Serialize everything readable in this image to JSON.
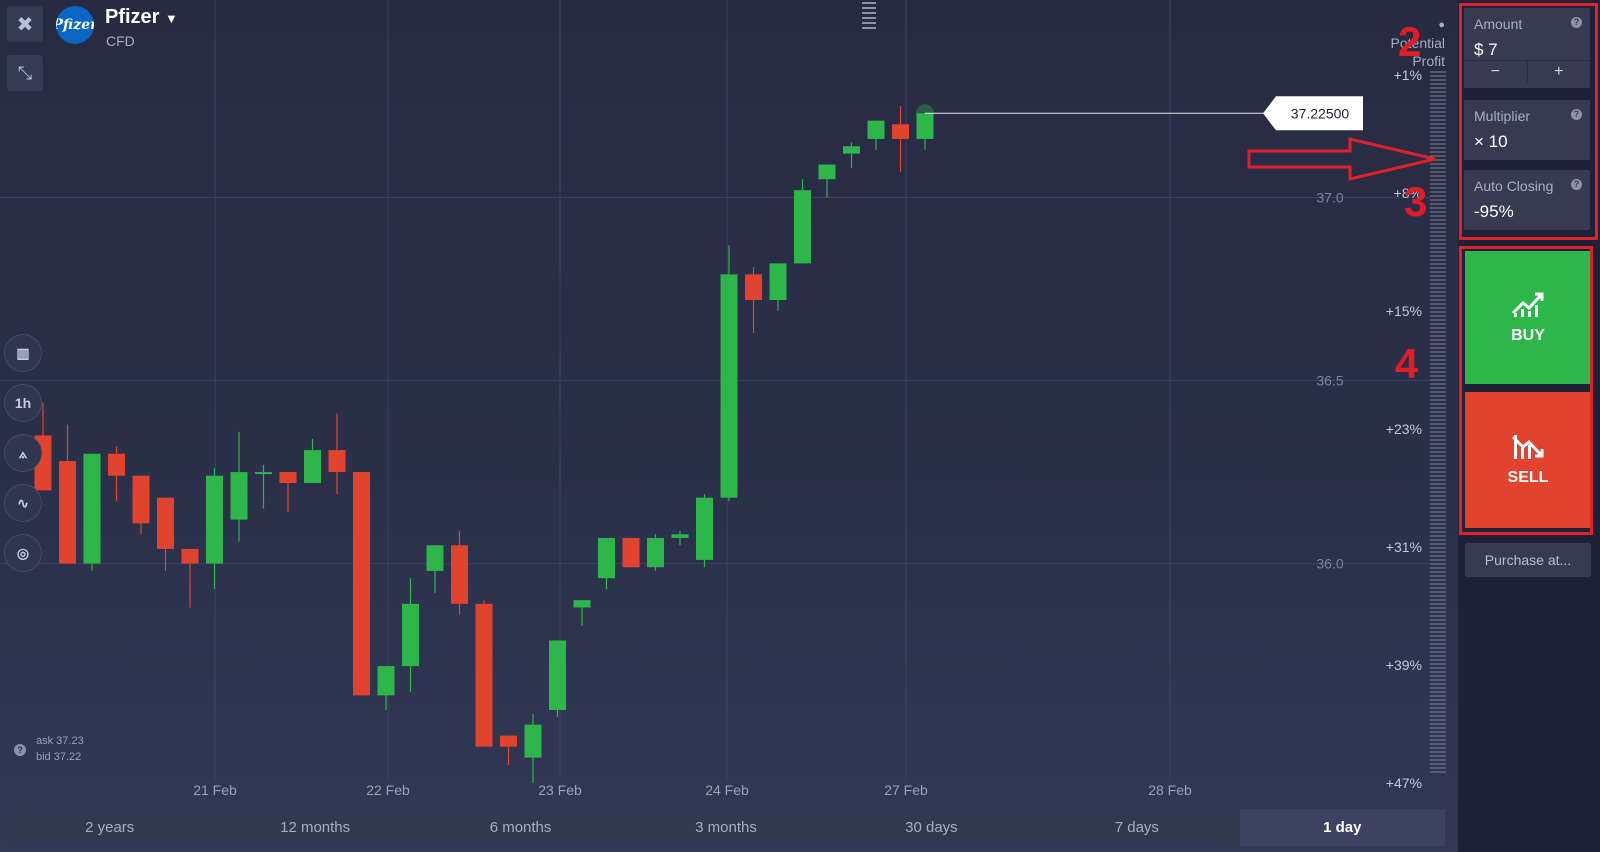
{
  "header": {
    "asset_name": "Pfizer",
    "asset_type": "CFD",
    "logo_text": "Pfizer"
  },
  "current_price_label": "37.22500",
  "ask_bid": {
    "ask": "ask 37.23",
    "bid": "bid 37.22"
  },
  "potential_profit_label": "Potential Profit",
  "periods": [
    {
      "label": "2 years",
      "active": false
    },
    {
      "label": "12 months",
      "active": false
    },
    {
      "label": "6 months",
      "active": false
    },
    {
      "label": "3 months",
      "active": false
    },
    {
      "label": "30 days",
      "active": false
    },
    {
      "label": "7 days",
      "active": false
    },
    {
      "label": "1 day",
      "active": true
    }
  ],
  "tools": {
    "timeframe": "1h"
  },
  "panel": {
    "amount": {
      "label": "Amount",
      "value": "$ 7",
      "minus": "−",
      "plus": "+"
    },
    "multiplier": {
      "label": "Multiplier",
      "value": "× 10"
    },
    "auto_closing": {
      "label": "Auto Closing",
      "value": "-95%"
    },
    "buy_label": "BUY",
    "sell_label": "SELL",
    "purchase_label": "Purchase at..."
  },
  "annotations": {
    "n2": "2",
    "n3": "3",
    "n4": "4"
  },
  "colors": {
    "up": "#2db64a",
    "down": "#e2432f",
    "annotation": "#e0202a",
    "background": "#2a2e46"
  },
  "chart_data": {
    "type": "candlestick",
    "x_ticks": [
      "21 Feb",
      "22 Feb",
      "23 Feb",
      "24 Feb",
      "27 Feb",
      "28 Feb"
    ],
    "y_ticks": [
      "36.0",
      "36.5",
      "37.0"
    ],
    "ylim": [
      35.6,
      37.28
    ],
    "profit_ticks": [
      "+1%",
      "+8%",
      "+15%",
      "+23%",
      "+31%",
      "+39%",
      "+47%"
    ],
    "candles": [
      {
        "o": 36.35,
        "h": 36.44,
        "l": 36.2,
        "c": 36.2
      },
      {
        "o": 36.28,
        "h": 36.38,
        "l": 36.01,
        "c": 36.0
      },
      {
        "o": 36.0,
        "h": 36.3,
        "l": 35.98,
        "c": 36.3
      },
      {
        "o": 36.3,
        "h": 36.32,
        "l": 36.17,
        "c": 36.24
      },
      {
        "o": 36.24,
        "h": 36.24,
        "l": 36.08,
        "c": 36.11
      },
      {
        "o": 36.18,
        "h": 36.18,
        "l": 35.98,
        "c": 36.04
      },
      {
        "o": 36.04,
        "h": 36.04,
        "l": 35.88,
        "c": 36.0
      },
      {
        "o": 36.0,
        "h": 36.26,
        "l": 35.93,
        "c": 36.24
      },
      {
        "o": 36.12,
        "h": 36.36,
        "l": 36.06,
        "c": 36.25
      },
      {
        "o": 36.25,
        "h": 36.27,
        "l": 36.15,
        "c": 36.25
      },
      {
        "o": 36.25,
        "h": 36.25,
        "l": 36.14,
        "c": 36.22
      },
      {
        "o": 36.22,
        "h": 36.34,
        "l": 36.22,
        "c": 36.31
      },
      {
        "o": 36.31,
        "h": 36.41,
        "l": 36.19,
        "c": 36.25
      },
      {
        "o": 36.25,
        "h": 36.25,
        "l": 35.76,
        "c": 35.64
      },
      {
        "o": 35.64,
        "h": 35.72,
        "l": 35.6,
        "c": 35.72
      },
      {
        "o": 35.72,
        "h": 35.96,
        "l": 35.65,
        "c": 35.89
      },
      {
        "o": 35.98,
        "h": 36.03,
        "l": 35.92,
        "c": 36.05
      },
      {
        "o": 36.05,
        "h": 36.09,
        "l": 35.86,
        "c": 35.89
      },
      {
        "o": 35.89,
        "h": 35.9,
        "l": 35.56,
        "c": 35.5
      },
      {
        "o": 35.53,
        "h": 35.53,
        "l": 35.45,
        "c": 35.5
      },
      {
        "o": 35.47,
        "h": 35.59,
        "l": 35.4,
        "c": 35.56
      },
      {
        "o": 35.6,
        "h": 35.78,
        "l": 35.58,
        "c": 35.79
      },
      {
        "o": 35.88,
        "h": 35.88,
        "l": 35.83,
        "c": 35.9
      },
      {
        "o": 35.96,
        "h": 36.07,
        "l": 35.93,
        "c": 36.07
      },
      {
        "o": 36.07,
        "h": 36.07,
        "l": 35.99,
        "c": 35.99
      },
      {
        "o": 35.99,
        "h": 36.08,
        "l": 35.98,
        "c": 36.07
      },
      {
        "o": 36.07,
        "h": 36.09,
        "l": 36.05,
        "c": 36.08
      },
      {
        "o": 36.01,
        "h": 36.19,
        "l": 35.99,
        "c": 36.18
      },
      {
        "o": 36.18,
        "h": 36.87,
        "l": 36.17,
        "c": 36.79
      },
      {
        "o": 36.79,
        "h": 36.81,
        "l": 36.63,
        "c": 36.72
      },
      {
        "o": 36.72,
        "h": 36.8,
        "l": 36.69,
        "c": 36.82
      },
      {
        "o": 36.82,
        "h": 37.05,
        "l": 36.82,
        "c": 37.02
      },
      {
        "o": 37.05,
        "h": 37.08,
        "l": 37.0,
        "c": 37.09
      },
      {
        "o": 37.12,
        "h": 37.15,
        "l": 37.08,
        "c": 37.14
      },
      {
        "o": 37.16,
        "h": 37.2,
        "l": 37.13,
        "c": 37.21
      },
      {
        "o": 37.2,
        "h": 37.25,
        "l": 37.07,
        "c": 37.16
      },
      {
        "o": 37.16,
        "h": 37.23,
        "l": 37.13,
        "c": 37.23
      }
    ]
  }
}
